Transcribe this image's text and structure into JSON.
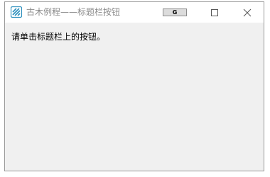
{
  "window": {
    "title": "古木例程——标题栏按钮",
    "app_icon": "app-logo-icon",
    "accent_color": "#2b8fbd"
  },
  "titlebar": {
    "custom_button_label": "G",
    "maximize_icon": "maximize-icon",
    "close_icon": "close-icon"
  },
  "client": {
    "message": "请单击标题栏上的按钮。"
  }
}
